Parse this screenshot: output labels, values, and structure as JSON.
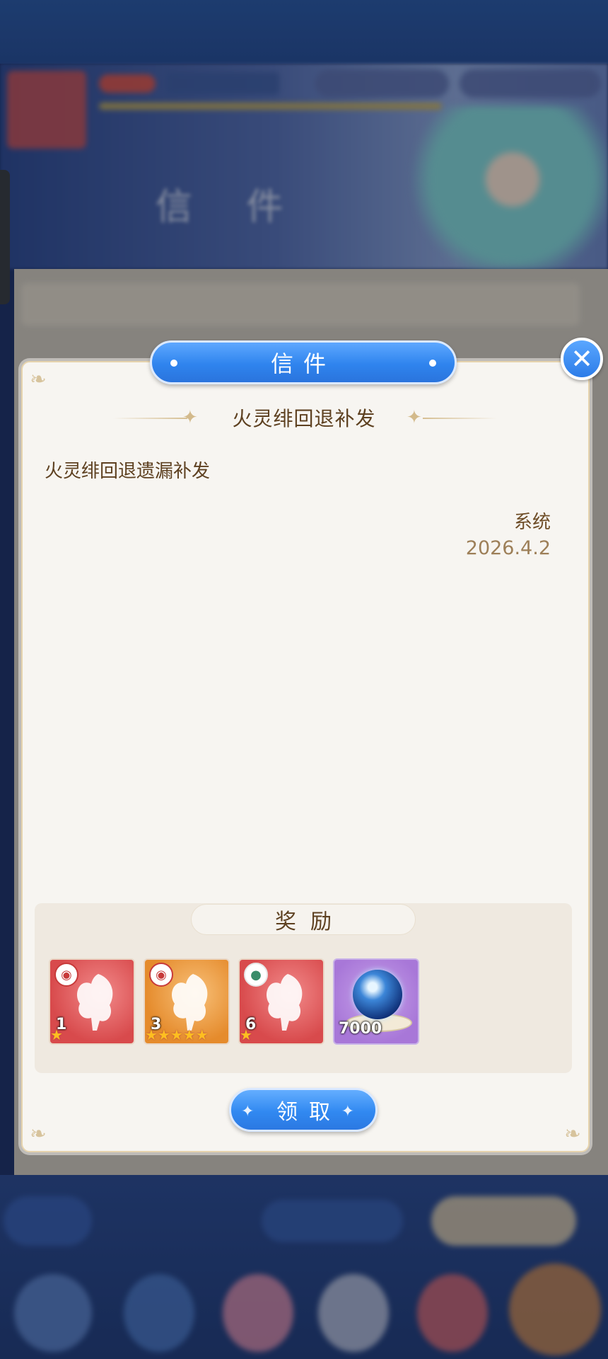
{
  "modal": {
    "title": "信件",
    "close_symbol": "✕",
    "mail_title": "火灵绯回退补发",
    "body": "火灵绯回退遗漏补发",
    "sender": "系统",
    "date": "2026.4.2"
  },
  "rewards": {
    "label": "奖励",
    "items": [
      {
        "type": "fairy-card",
        "badge_icon": "bag-icon",
        "count": "1",
        "stars": 1,
        "color": "red"
      },
      {
        "type": "fairy-card",
        "badge_icon": "bag-icon",
        "count": "3",
        "stars": 5,
        "color": "orange"
      },
      {
        "type": "fairy-card",
        "badge_icon": "tri-orb-icon",
        "count": "6",
        "stars": 1,
        "color": "red"
      },
      {
        "type": "crystal-orb",
        "count": "7000",
        "color": "purple"
      }
    ]
  },
  "claim_button": {
    "label": "领取"
  },
  "colors": {
    "accent_blue": "#2f84ee",
    "panel_bg": "#f7f5f1",
    "text_brown": "#5e4121",
    "date_brown": "#9d7f58",
    "border_gold": "#e6d3ad"
  }
}
